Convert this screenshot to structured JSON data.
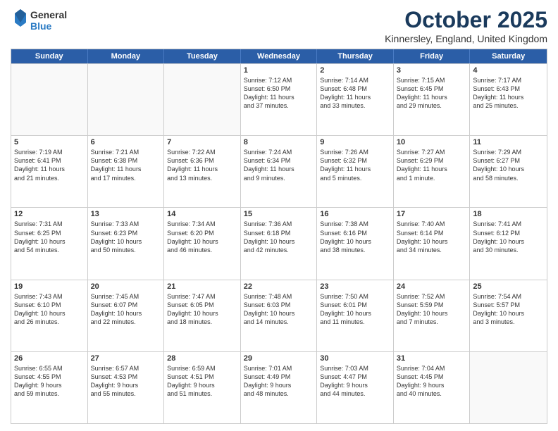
{
  "logo": {
    "line1": "General",
    "line2": "Blue"
  },
  "title": "October 2025",
  "subtitle": "Kinnersley, England, United Kingdom",
  "days": [
    "Sunday",
    "Monday",
    "Tuesday",
    "Wednesday",
    "Thursday",
    "Friday",
    "Saturday"
  ],
  "rows": [
    [
      {
        "day": "",
        "text": ""
      },
      {
        "day": "",
        "text": ""
      },
      {
        "day": "",
        "text": ""
      },
      {
        "day": "1",
        "text": "Sunrise: 7:12 AM\nSunset: 6:50 PM\nDaylight: 11 hours\nand 37 minutes."
      },
      {
        "day": "2",
        "text": "Sunrise: 7:14 AM\nSunset: 6:48 PM\nDaylight: 11 hours\nand 33 minutes."
      },
      {
        "day": "3",
        "text": "Sunrise: 7:15 AM\nSunset: 6:45 PM\nDaylight: 11 hours\nand 29 minutes."
      },
      {
        "day": "4",
        "text": "Sunrise: 7:17 AM\nSunset: 6:43 PM\nDaylight: 11 hours\nand 25 minutes."
      }
    ],
    [
      {
        "day": "5",
        "text": "Sunrise: 7:19 AM\nSunset: 6:41 PM\nDaylight: 11 hours\nand 21 minutes."
      },
      {
        "day": "6",
        "text": "Sunrise: 7:21 AM\nSunset: 6:38 PM\nDaylight: 11 hours\nand 17 minutes."
      },
      {
        "day": "7",
        "text": "Sunrise: 7:22 AM\nSunset: 6:36 PM\nDaylight: 11 hours\nand 13 minutes."
      },
      {
        "day": "8",
        "text": "Sunrise: 7:24 AM\nSunset: 6:34 PM\nDaylight: 11 hours\nand 9 minutes."
      },
      {
        "day": "9",
        "text": "Sunrise: 7:26 AM\nSunset: 6:32 PM\nDaylight: 11 hours\nand 5 minutes."
      },
      {
        "day": "10",
        "text": "Sunrise: 7:27 AM\nSunset: 6:29 PM\nDaylight: 11 hours\nand 1 minute."
      },
      {
        "day": "11",
        "text": "Sunrise: 7:29 AM\nSunset: 6:27 PM\nDaylight: 10 hours\nand 58 minutes."
      }
    ],
    [
      {
        "day": "12",
        "text": "Sunrise: 7:31 AM\nSunset: 6:25 PM\nDaylight: 10 hours\nand 54 minutes."
      },
      {
        "day": "13",
        "text": "Sunrise: 7:33 AM\nSunset: 6:23 PM\nDaylight: 10 hours\nand 50 minutes."
      },
      {
        "day": "14",
        "text": "Sunrise: 7:34 AM\nSunset: 6:20 PM\nDaylight: 10 hours\nand 46 minutes."
      },
      {
        "day": "15",
        "text": "Sunrise: 7:36 AM\nSunset: 6:18 PM\nDaylight: 10 hours\nand 42 minutes."
      },
      {
        "day": "16",
        "text": "Sunrise: 7:38 AM\nSunset: 6:16 PM\nDaylight: 10 hours\nand 38 minutes."
      },
      {
        "day": "17",
        "text": "Sunrise: 7:40 AM\nSunset: 6:14 PM\nDaylight: 10 hours\nand 34 minutes."
      },
      {
        "day": "18",
        "text": "Sunrise: 7:41 AM\nSunset: 6:12 PM\nDaylight: 10 hours\nand 30 minutes."
      }
    ],
    [
      {
        "day": "19",
        "text": "Sunrise: 7:43 AM\nSunset: 6:10 PM\nDaylight: 10 hours\nand 26 minutes."
      },
      {
        "day": "20",
        "text": "Sunrise: 7:45 AM\nSunset: 6:07 PM\nDaylight: 10 hours\nand 22 minutes."
      },
      {
        "day": "21",
        "text": "Sunrise: 7:47 AM\nSunset: 6:05 PM\nDaylight: 10 hours\nand 18 minutes."
      },
      {
        "day": "22",
        "text": "Sunrise: 7:48 AM\nSunset: 6:03 PM\nDaylight: 10 hours\nand 14 minutes."
      },
      {
        "day": "23",
        "text": "Sunrise: 7:50 AM\nSunset: 6:01 PM\nDaylight: 10 hours\nand 11 minutes."
      },
      {
        "day": "24",
        "text": "Sunrise: 7:52 AM\nSunset: 5:59 PM\nDaylight: 10 hours\nand 7 minutes."
      },
      {
        "day": "25",
        "text": "Sunrise: 7:54 AM\nSunset: 5:57 PM\nDaylight: 10 hours\nand 3 minutes."
      }
    ],
    [
      {
        "day": "26",
        "text": "Sunrise: 6:55 AM\nSunset: 4:55 PM\nDaylight: 9 hours\nand 59 minutes."
      },
      {
        "day": "27",
        "text": "Sunrise: 6:57 AM\nSunset: 4:53 PM\nDaylight: 9 hours\nand 55 minutes."
      },
      {
        "day": "28",
        "text": "Sunrise: 6:59 AM\nSunset: 4:51 PM\nDaylight: 9 hours\nand 51 minutes."
      },
      {
        "day": "29",
        "text": "Sunrise: 7:01 AM\nSunset: 4:49 PM\nDaylight: 9 hours\nand 48 minutes."
      },
      {
        "day": "30",
        "text": "Sunrise: 7:03 AM\nSunset: 4:47 PM\nDaylight: 9 hours\nand 44 minutes."
      },
      {
        "day": "31",
        "text": "Sunrise: 7:04 AM\nSunset: 4:45 PM\nDaylight: 9 hours\nand 40 minutes."
      },
      {
        "day": "",
        "text": ""
      }
    ]
  ]
}
